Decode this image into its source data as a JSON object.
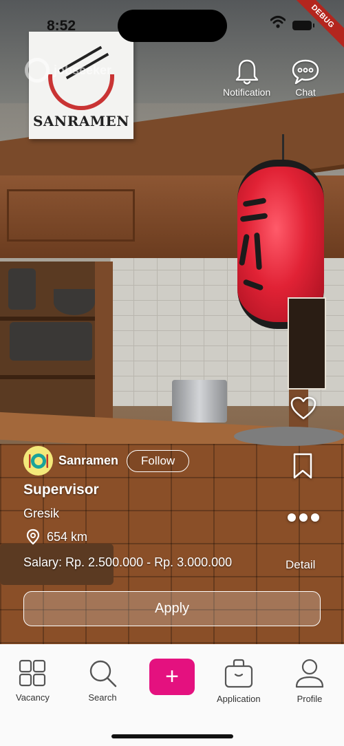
{
  "status_bar": {
    "time": "8:52",
    "debug_label": "DEBUG"
  },
  "background": {
    "sign_text": "SANRAMEN",
    "watermark_text": "jobseeker"
  },
  "top_actions": {
    "notification_label": "Notification",
    "chat_label": "Chat"
  },
  "side_actions": {
    "detail_label": "Detail"
  },
  "job": {
    "company_name": "Sanramen",
    "follow_label": "Follow",
    "title": "Supervisor",
    "city": "Gresik",
    "distance": "654 km",
    "salary": "Salary: Rp. 2.500.000 - Rp. 3.000.000",
    "apply_label": "Apply"
  },
  "bottom_nav": {
    "items": [
      {
        "label": "Vacancy",
        "icon": "grid-icon"
      },
      {
        "label": "Search",
        "icon": "search-icon"
      },
      {
        "label": "+",
        "icon": "plus-icon"
      },
      {
        "label": "Application",
        "icon": "briefcase-icon"
      },
      {
        "label": "Profile",
        "icon": "profile-icon"
      }
    ]
  },
  "colors": {
    "accent": "#e4117f",
    "debug_banner": "#b3261e",
    "nav_background": "#fafafa"
  }
}
